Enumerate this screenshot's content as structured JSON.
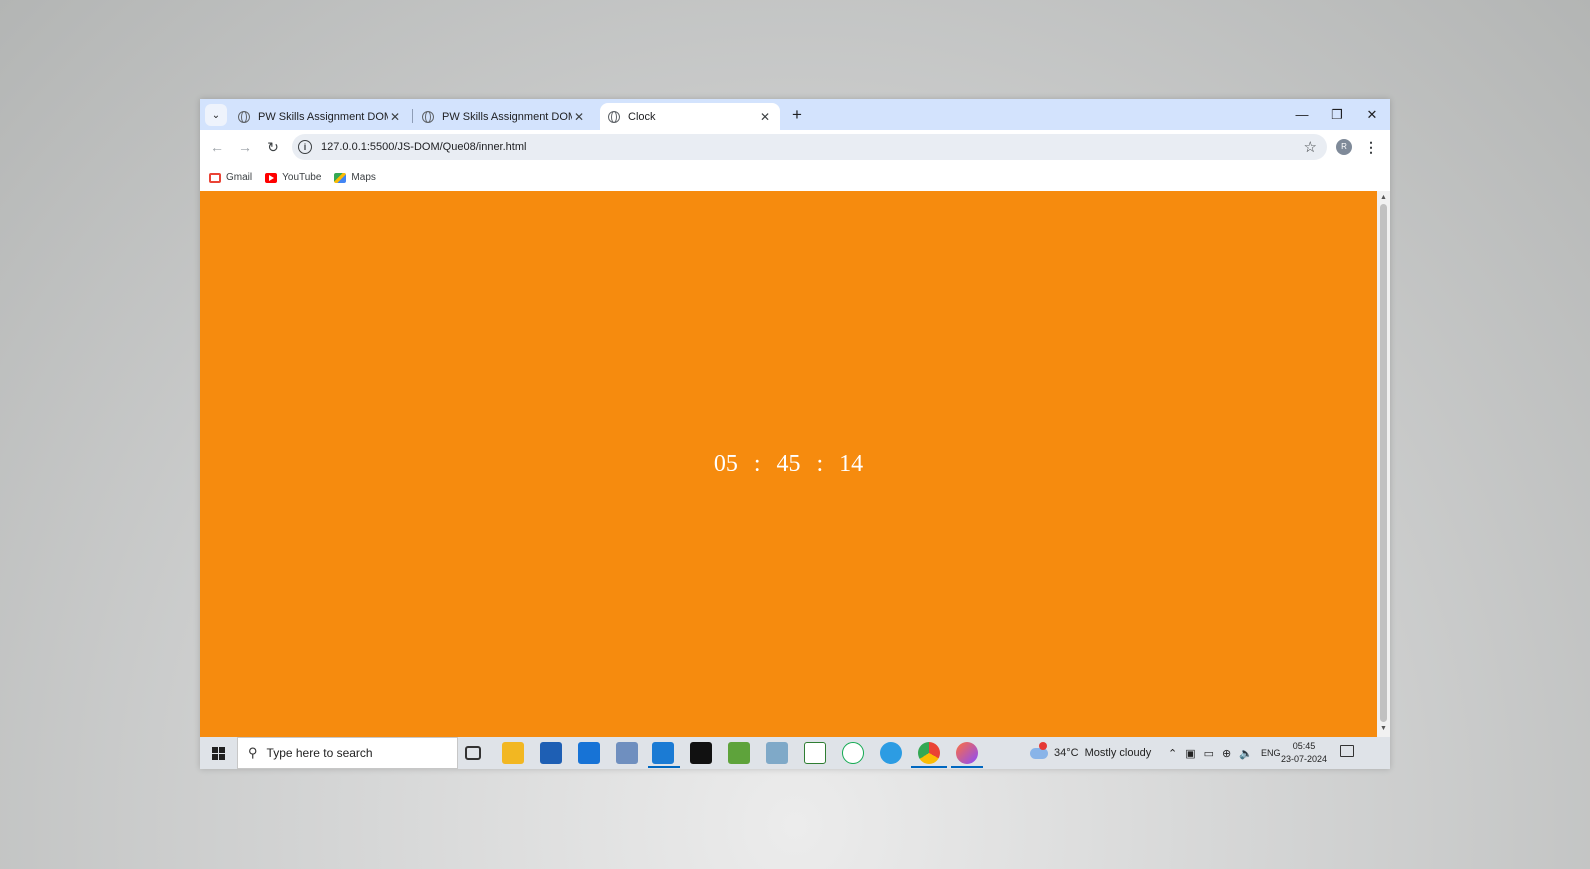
{
  "browser": {
    "tabs": [
      {
        "title": "PW Skills Assignment DOM-Ma",
        "active": false
      },
      {
        "title": "PW Skills Assignment DOM-Ma",
        "active": false
      },
      {
        "title": "Clock",
        "active": true
      }
    ],
    "address": "127.0.0.1:5500/JS-DOM/Que08/inner.html",
    "profile_initial": "R",
    "bookmarks": [
      {
        "label": "Gmail",
        "icon": "gmail-icon"
      },
      {
        "label": "YouTube",
        "icon": "youtube-icon"
      },
      {
        "label": "Maps",
        "icon": "maps-icon"
      }
    ]
  },
  "page": {
    "background": "#f68b0e",
    "clock": {
      "hours": "05",
      "minutes": "45",
      "seconds": "14",
      "separator": ":"
    }
  },
  "taskbar": {
    "search_placeholder": "Type here to search",
    "weather": {
      "temp": "34°C",
      "condition": "Mostly cloudy"
    },
    "language": "ENG",
    "time": "05:45",
    "date": "23-07-2024"
  }
}
